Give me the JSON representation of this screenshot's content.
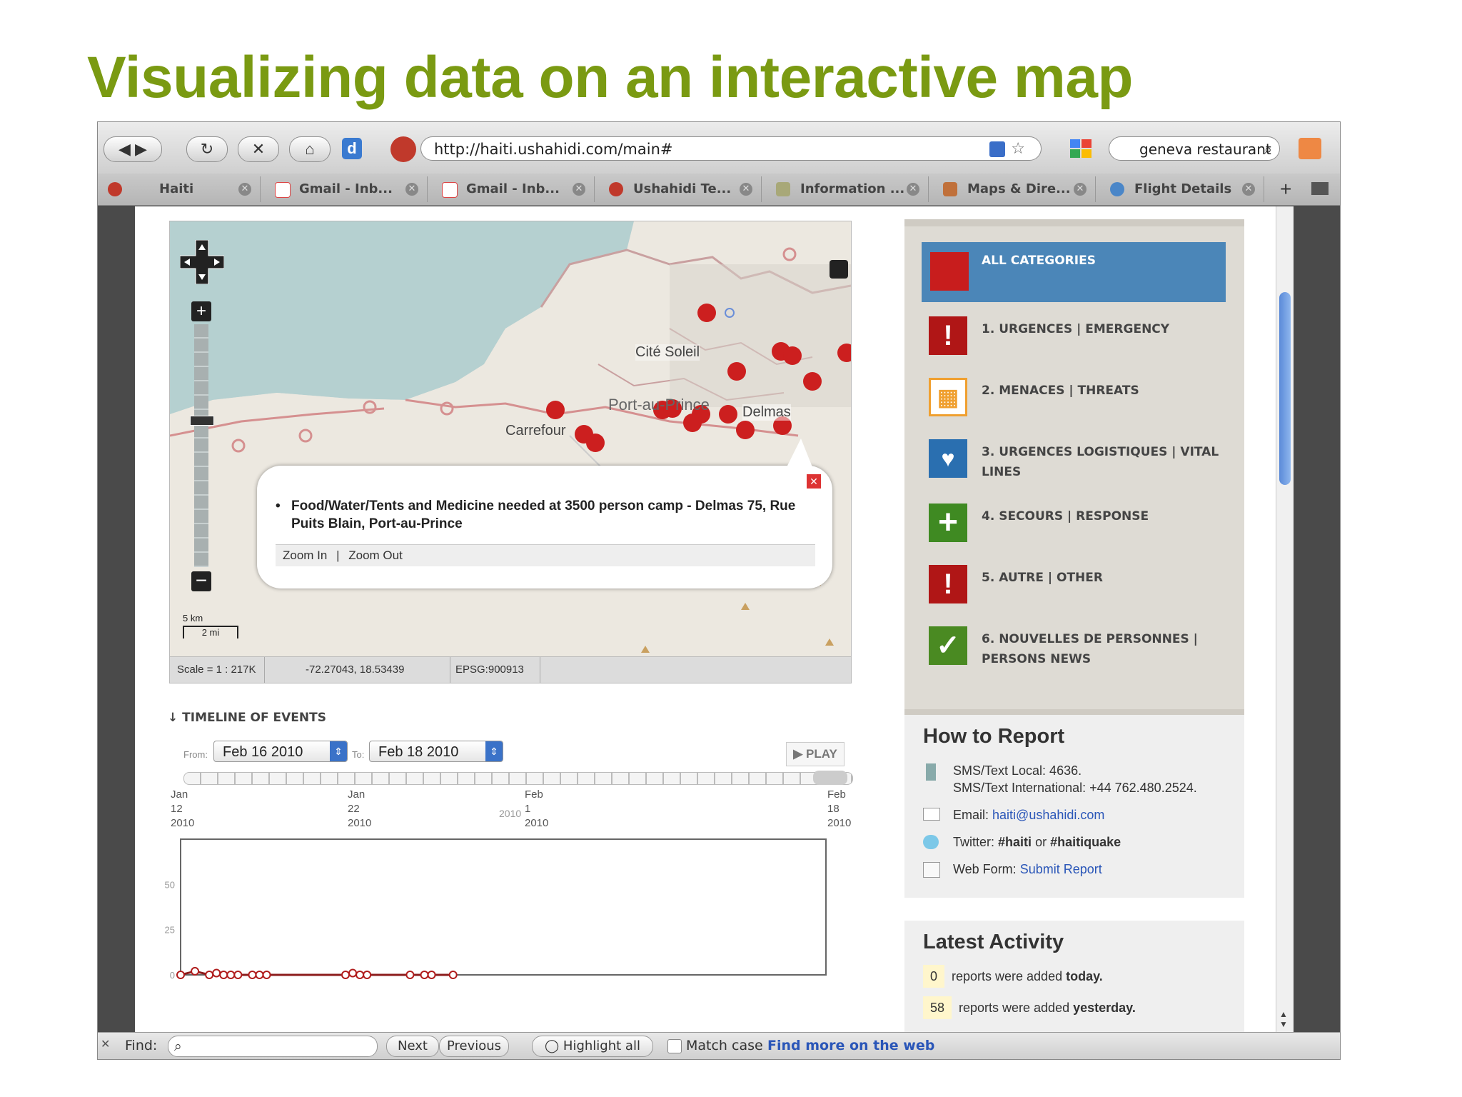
{
  "slide": {
    "title": "Visualizing data on an interactive map"
  },
  "browser": {
    "url": "http://haiti.ushahidi.com/main#",
    "search_text": "geneva restaurant",
    "tabs": [
      {
        "label": "Haiti",
        "color": "#c0392b"
      },
      {
        "label": "Gmail - Inb...",
        "color": "#d44"
      },
      {
        "label": "Gmail - Inb...",
        "color": "#d44"
      },
      {
        "label": "Ushahidi Te...",
        "color": "#c0392b"
      },
      {
        "label": "Information ...",
        "color": "#9a9a6a"
      },
      {
        "label": "Maps & Dire...",
        "color": "#c0703a"
      },
      {
        "label": "Flight Details",
        "color": "#4a86c8"
      }
    ]
  },
  "map": {
    "labels": {
      "cite_soleil": "Cité Soleil",
      "port_au_prince": "Port-au-Prince",
      "delmas": "Delmas",
      "carrefour": "Carrefour"
    },
    "popup": {
      "report": "Food/Water/Tents and Medicine needed at 3500 person camp - Delmas 75, Rue Puits Blain, Port-au-Prince",
      "zoom_in": "Zoom In",
      "separator": "|",
      "zoom_out": "Zoom Out"
    },
    "scale_bar": {
      "km": "5 km",
      "mi": "2 mi"
    },
    "status": {
      "scale": "Scale = 1 : 217K",
      "coords": "-72.27043, 18.53439",
      "epsg": "EPSG:900913"
    }
  },
  "categories": [
    {
      "label": "ALL CATEGORIES",
      "color": "#c81d1d",
      "icon": "all-icon",
      "glyph": ""
    },
    {
      "label": "1. URGENCES | EMERGENCY",
      "color": "#b01616",
      "icon": "exclamation-icon",
      "glyph": "!"
    },
    {
      "label": "2. MENACES | THREATS",
      "color": "#f0a030",
      "icon": "threat-icon",
      "glyph": "▦"
    },
    {
      "label": "3. URGENCES LOGISTIQUES | VITAL LINES",
      "color": "#2a6fb0",
      "icon": "vital-lines-icon",
      "glyph": "♥"
    },
    {
      "label": "4. SECOURS | RESPONSE",
      "color": "#3f8a22",
      "icon": "plus-icon",
      "glyph": "+"
    },
    {
      "label": "5. AUTRE | OTHER",
      "color": "#b01616",
      "icon": "exclamation-icon",
      "glyph": "!"
    },
    {
      "label": "6. NOUVELLES DE PERSONNES | PERSONS NEWS",
      "color": "#4a8a22",
      "icon": "person-news-icon",
      "glyph": "✓"
    }
  ],
  "how_to_report": {
    "title": "How to Report",
    "sms_local": "SMS/Text Local: 4636.",
    "sms_intl": "SMS/Text International: +44 762.480.2524.",
    "email_label": "Email:",
    "email": "haiti@ushahidi.com",
    "twitter_label": "Twitter:",
    "twitter_tag1": "#haiti",
    "twitter_or": "or",
    "twitter_tag2": "#haitiquake",
    "webform_label": "Web Form:",
    "webform_link": "Submit Report"
  },
  "latest_activity": {
    "title": "Latest Activity",
    "today_count": "0",
    "today_text": "reports were added",
    "today_word": "today.",
    "yesterday_count": "58",
    "yesterday_text": "reports were added",
    "yesterday_word": "yesterday."
  },
  "timeline": {
    "heading": "TIMELINE OF EVENTS",
    "from_label": "From:",
    "from_value": "Feb 16 2010",
    "to_label": "To:",
    "to_value": "Feb 18 2010",
    "play": "PLAY",
    "date_ticks": [
      {
        "l1": "Jan",
        "l2": "12",
        "l3": "2010"
      },
      {
        "l1": "Jan",
        "l2": "22",
        "l3": "2010"
      },
      {
        "l1": "Feb",
        "l2": "1",
        "l3": "2010"
      },
      {
        "l1": "Feb",
        "l2": "18",
        "l3": "2010"
      }
    ],
    "stray_label": "2010"
  },
  "chart_data": {
    "type": "line",
    "ylim": [
      0,
      75
    ],
    "yticks": [
      "0",
      "25",
      "50"
    ],
    "series": [
      {
        "values": [
          0,
          2,
          0,
          1,
          0,
          0,
          0,
          0,
          0,
          0,
          0,
          1,
          0,
          0,
          0,
          0,
          0,
          0
        ]
      }
    ],
    "x": [
      0,
      1,
      2,
      2.5,
      3,
      3.5,
      4,
      5,
      5.5,
      6,
      11.5,
      12,
      12.5,
      13,
      16,
      17,
      17.5,
      19
    ]
  },
  "findbar": {
    "find_label": "Find:",
    "next": "Next",
    "previous": "Previous",
    "highlight_all": "Highlight all",
    "match_case": "Match case",
    "find_more": "Find more on the web"
  }
}
